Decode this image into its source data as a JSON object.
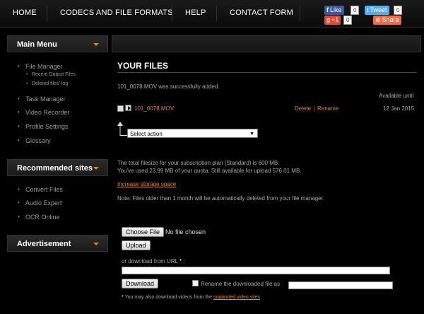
{
  "nav": {
    "items": [
      "HOME",
      "CODECS AND FILE FORMATS",
      "HELP",
      "CONTACT FORM"
    ],
    "social": {
      "like_label": "Like",
      "like_count": "0",
      "tweet_label": "Tweet",
      "tweet_count": "0",
      "gplus_label": "+1",
      "gplus_count": "0",
      "share_label": "Share"
    }
  },
  "sidebar": {
    "main_menu": {
      "title": "Main Menu",
      "items": [
        "File Manager",
        "Task Manager",
        "Video Recorder",
        "Profile Settings",
        "Glossary"
      ],
      "subitems": [
        "Recent Output Files",
        "Deleted files' log"
      ]
    },
    "recommended": {
      "title": "Recommended sites",
      "items": [
        "Convert Files",
        "Audio Expert",
        "OCR Online"
      ]
    },
    "advertisement": {
      "title": "Advertisement"
    }
  },
  "files": {
    "title": "YOUR FILES",
    "success_message": "101_0078.MOV was successfully added.",
    "available_until_header": "Available until",
    "file_name": "101_0078.MOV",
    "delete_label": "Delete",
    "separator": "|",
    "rename_label": "Rename",
    "file_date": "12 Jan 2015",
    "select_action": "Select action",
    "quota_line1": "The total filesize for your subscription plan (Standard) is 600 MB.",
    "quota_line2": "You've used 23.99 MB of your quota. Still available for upload 576.01 MB.",
    "increase_storage": "Increase storage space",
    "note": "Note: Files older than 1 month will be automatically deleted from your file manager."
  },
  "upload": {
    "choose_file": "Choose File",
    "no_file": "No file chosen",
    "upload_button": "Upload",
    "url_label": "or download from URL",
    "asterisk": "*",
    "colon": ":",
    "download_button": "Download",
    "rename_label": "Rename the downloaded file as",
    "footnote_prefix": "You may also download videos from the",
    "footnote_link": "supported video sites"
  },
  "colors": {
    "accent": "#e08a1e",
    "facebook": "#3b5998",
    "twitter": "#55acee",
    "gplus": "#dd4b39",
    "share": "#f26a46"
  }
}
